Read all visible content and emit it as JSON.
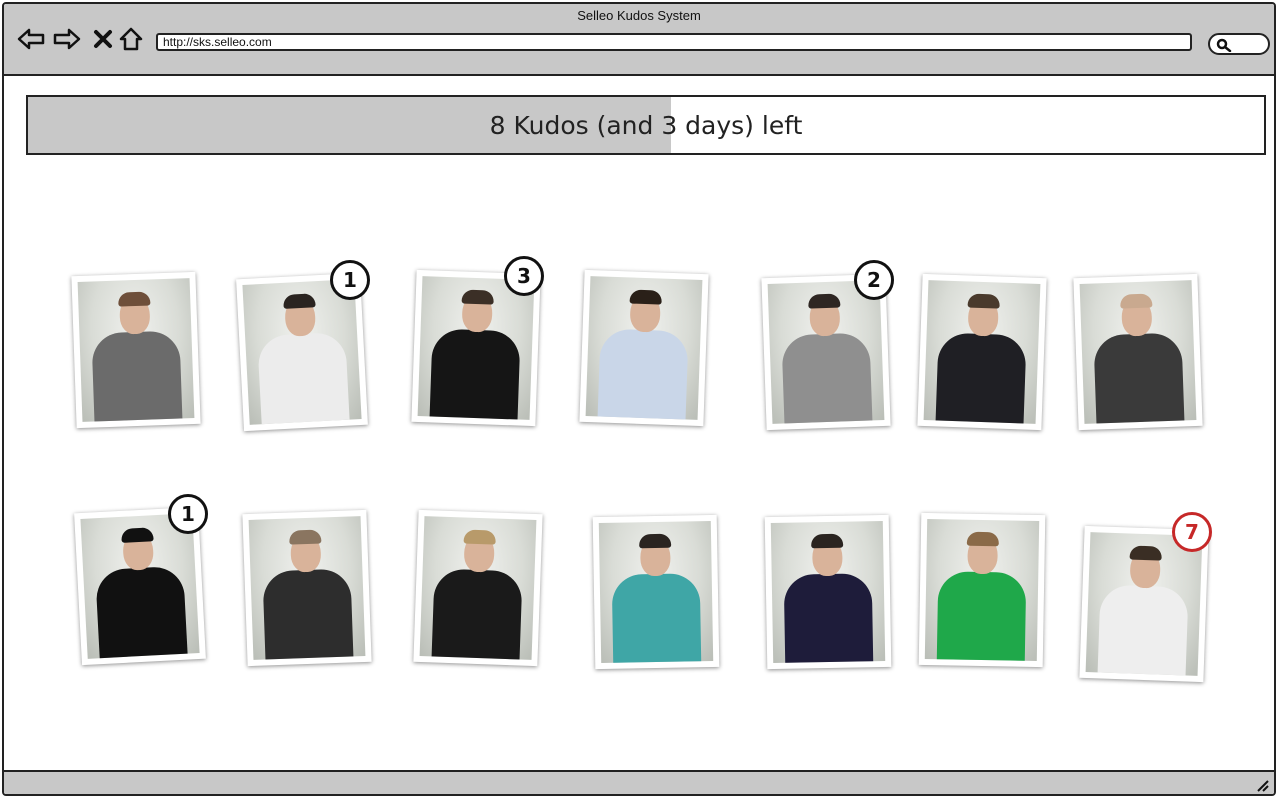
{
  "window": {
    "title": "Selleo Kudos System"
  },
  "browser": {
    "url": "http://sks.selleo.com"
  },
  "banner": {
    "text": "8 Kudos (and 3 days) left",
    "progress": 0.52
  },
  "colors": {
    "chrome": "#c8c8c8",
    "badge": "#111111",
    "badge_alert": "#c62828"
  },
  "people": [
    {
      "shirt": "#6b6b6b",
      "hair": "#6e4f3a",
      "kudos": ""
    },
    {
      "shirt": "#ececec",
      "hair": "#2a2420",
      "kudos": "1"
    },
    {
      "shirt": "#151515",
      "hair": "#3b2f26",
      "kudos": "3"
    },
    {
      "shirt": "#c9d6e8",
      "hair": "#2a2018",
      "kudos": ""
    },
    {
      "shirt": "#8f8f8f",
      "hair": "#2e2622",
      "kudos": "2"
    },
    {
      "shirt": "#1f1f24",
      "hair": "#4a3a2c",
      "kudos": ""
    },
    {
      "shirt": "#3a3a3a",
      "hair": "#c9a98f",
      "kudos": ""
    },
    {
      "shirt": "#111111",
      "hair": "#111111",
      "kudos": "1"
    },
    {
      "shirt": "#2d2d2d",
      "hair": "#8a7560",
      "kudos": ""
    },
    {
      "shirt": "#1a1a1a",
      "hair": "#b89a6a",
      "kudos": ""
    },
    {
      "shirt": "#3fa6a6",
      "hair": "#2a2420",
      "kudos": ""
    },
    {
      "shirt": "#1e1c3a",
      "hair": "#2a2420",
      "kudos": ""
    },
    {
      "shirt": "#1fa84a",
      "hair": "#8a6a48",
      "kudos": ""
    },
    {
      "shirt": "#eeeeee",
      "hair": "#3a2e24",
      "kudos": "7",
      "alert": true
    }
  ]
}
